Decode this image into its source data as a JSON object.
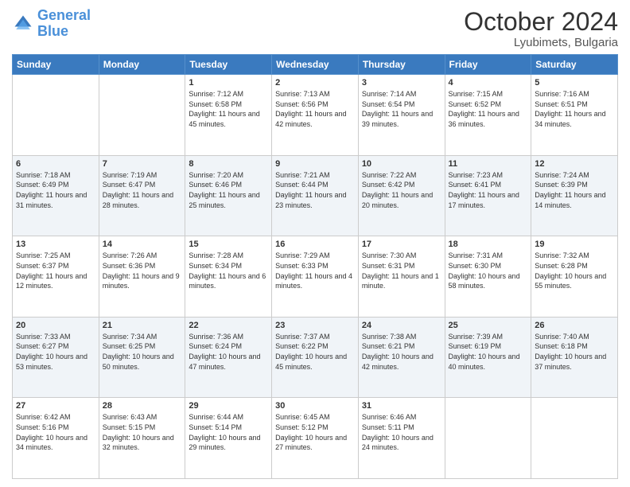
{
  "logo": {
    "line1": "General",
    "line2": "Blue"
  },
  "header": {
    "month": "October 2024",
    "location": "Lyubimets, Bulgaria"
  },
  "weekdays": [
    "Sunday",
    "Monday",
    "Tuesday",
    "Wednesday",
    "Thursday",
    "Friday",
    "Saturday"
  ],
  "weeks": [
    [
      {
        "day": "",
        "info": ""
      },
      {
        "day": "",
        "info": ""
      },
      {
        "day": "1",
        "info": "Sunrise: 7:12 AM\nSunset: 6:58 PM\nDaylight: 11 hours and 45 minutes."
      },
      {
        "day": "2",
        "info": "Sunrise: 7:13 AM\nSunset: 6:56 PM\nDaylight: 11 hours and 42 minutes."
      },
      {
        "day": "3",
        "info": "Sunrise: 7:14 AM\nSunset: 6:54 PM\nDaylight: 11 hours and 39 minutes."
      },
      {
        "day": "4",
        "info": "Sunrise: 7:15 AM\nSunset: 6:52 PM\nDaylight: 11 hours and 36 minutes."
      },
      {
        "day": "5",
        "info": "Sunrise: 7:16 AM\nSunset: 6:51 PM\nDaylight: 11 hours and 34 minutes."
      }
    ],
    [
      {
        "day": "6",
        "info": "Sunrise: 7:18 AM\nSunset: 6:49 PM\nDaylight: 11 hours and 31 minutes."
      },
      {
        "day": "7",
        "info": "Sunrise: 7:19 AM\nSunset: 6:47 PM\nDaylight: 11 hours and 28 minutes."
      },
      {
        "day": "8",
        "info": "Sunrise: 7:20 AM\nSunset: 6:46 PM\nDaylight: 11 hours and 25 minutes."
      },
      {
        "day": "9",
        "info": "Sunrise: 7:21 AM\nSunset: 6:44 PM\nDaylight: 11 hours and 23 minutes."
      },
      {
        "day": "10",
        "info": "Sunrise: 7:22 AM\nSunset: 6:42 PM\nDaylight: 11 hours and 20 minutes."
      },
      {
        "day": "11",
        "info": "Sunrise: 7:23 AM\nSunset: 6:41 PM\nDaylight: 11 hours and 17 minutes."
      },
      {
        "day": "12",
        "info": "Sunrise: 7:24 AM\nSunset: 6:39 PM\nDaylight: 11 hours and 14 minutes."
      }
    ],
    [
      {
        "day": "13",
        "info": "Sunrise: 7:25 AM\nSunset: 6:37 PM\nDaylight: 11 hours and 12 minutes."
      },
      {
        "day": "14",
        "info": "Sunrise: 7:26 AM\nSunset: 6:36 PM\nDaylight: 11 hours and 9 minutes."
      },
      {
        "day": "15",
        "info": "Sunrise: 7:28 AM\nSunset: 6:34 PM\nDaylight: 11 hours and 6 minutes."
      },
      {
        "day": "16",
        "info": "Sunrise: 7:29 AM\nSunset: 6:33 PM\nDaylight: 11 hours and 4 minutes."
      },
      {
        "day": "17",
        "info": "Sunrise: 7:30 AM\nSunset: 6:31 PM\nDaylight: 11 hours and 1 minute."
      },
      {
        "day": "18",
        "info": "Sunrise: 7:31 AM\nSunset: 6:30 PM\nDaylight: 10 hours and 58 minutes."
      },
      {
        "day": "19",
        "info": "Sunrise: 7:32 AM\nSunset: 6:28 PM\nDaylight: 10 hours and 55 minutes."
      }
    ],
    [
      {
        "day": "20",
        "info": "Sunrise: 7:33 AM\nSunset: 6:27 PM\nDaylight: 10 hours and 53 minutes."
      },
      {
        "day": "21",
        "info": "Sunrise: 7:34 AM\nSunset: 6:25 PM\nDaylight: 10 hours and 50 minutes."
      },
      {
        "day": "22",
        "info": "Sunrise: 7:36 AM\nSunset: 6:24 PM\nDaylight: 10 hours and 47 minutes."
      },
      {
        "day": "23",
        "info": "Sunrise: 7:37 AM\nSunset: 6:22 PM\nDaylight: 10 hours and 45 minutes."
      },
      {
        "day": "24",
        "info": "Sunrise: 7:38 AM\nSunset: 6:21 PM\nDaylight: 10 hours and 42 minutes."
      },
      {
        "day": "25",
        "info": "Sunrise: 7:39 AM\nSunset: 6:19 PM\nDaylight: 10 hours and 40 minutes."
      },
      {
        "day": "26",
        "info": "Sunrise: 7:40 AM\nSunset: 6:18 PM\nDaylight: 10 hours and 37 minutes."
      }
    ],
    [
      {
        "day": "27",
        "info": "Sunrise: 6:42 AM\nSunset: 5:16 PM\nDaylight: 10 hours and 34 minutes."
      },
      {
        "day": "28",
        "info": "Sunrise: 6:43 AM\nSunset: 5:15 PM\nDaylight: 10 hours and 32 minutes."
      },
      {
        "day": "29",
        "info": "Sunrise: 6:44 AM\nSunset: 5:14 PM\nDaylight: 10 hours and 29 minutes."
      },
      {
        "day": "30",
        "info": "Sunrise: 6:45 AM\nSunset: 5:12 PM\nDaylight: 10 hours and 27 minutes."
      },
      {
        "day": "31",
        "info": "Sunrise: 6:46 AM\nSunset: 5:11 PM\nDaylight: 10 hours and 24 minutes."
      },
      {
        "day": "",
        "info": ""
      },
      {
        "day": "",
        "info": ""
      }
    ]
  ]
}
